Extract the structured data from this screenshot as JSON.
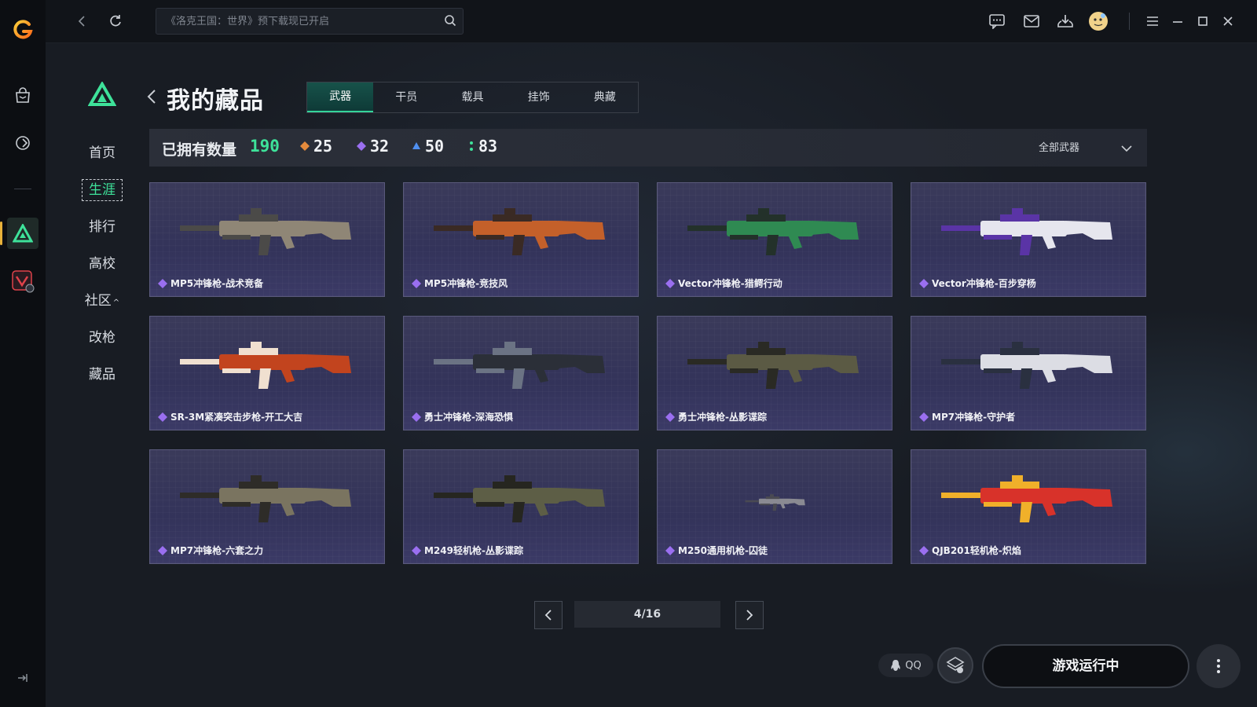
{
  "colors": {
    "accent": "#3ee29a",
    "brand_orange": "#e8b23a",
    "card_bg": "#36365a"
  },
  "topbar": {
    "search_placeholder": "《洛克王国：世界》预下载现已开启",
    "icons": [
      "back-icon",
      "refresh-icon",
      "search-icon",
      "chat-icon",
      "mail-icon",
      "download-icon",
      "avatar",
      "menu-icon",
      "minimize-icon",
      "maximize-icon",
      "close-icon"
    ]
  },
  "rail": {
    "icons": [
      "app-logo",
      "store-icon",
      "game-controller-icon",
      "delta-force-icon",
      "valorant-icon",
      "collapse-icon"
    ]
  },
  "nav": {
    "items": [
      "首页",
      "生涯",
      "排行",
      "高校",
      "社区",
      "改枪",
      "藏品"
    ],
    "active": "生涯"
  },
  "header": {
    "title": "我的藏品",
    "tabs": [
      "武器",
      "干员",
      "载具",
      "挂饰",
      "典藏"
    ],
    "active_tab": "武器"
  },
  "owned": {
    "label": "已拥有数量",
    "total": "190",
    "rarity_counts": [
      {
        "rarity": "orange",
        "color": "#e48a3c",
        "count": "25"
      },
      {
        "rarity": "purple",
        "color": "#9a6ff0",
        "count": "32"
      },
      {
        "rarity": "blue",
        "color": "#4f8ff0",
        "count": "50"
      },
      {
        "rarity": "green",
        "color": "#3ee29a",
        "count": "83"
      }
    ],
    "filter": "全部武器"
  },
  "items": [
    {
      "name": "MP5冲锋枪-战术竞备",
      "gun": "#8f8676",
      "gun2": "#4b4a48"
    },
    {
      "name": "MP5冲锋枪-竞技风",
      "gun": "#c4602a",
      "gun2": "#3a2a24"
    },
    {
      "name": "Vector冲锋枪-猎鳄行动",
      "gun": "#2f8a52",
      "gun2": "#23312a"
    },
    {
      "name": "Vector冲锋枪-百步穿杨",
      "gun": "#e6e6ee",
      "gun2": "#5a34a6"
    },
    {
      "name": "SR-3M紧凑突击步枪-开工大吉",
      "gun": "#c2441e",
      "gun2": "#f0e0d0"
    },
    {
      "name": "勇士冲锋枪-深海恐惧",
      "gun": "#2b2f38",
      "gun2": "#6b7384"
    },
    {
      "name": "勇士冲锋枪-丛影谍踪",
      "gun": "#5b5a44",
      "gun2": "#2a2a24"
    },
    {
      "name": "MP7冲锋枪-守护者",
      "gun": "#dcdde4",
      "gun2": "#2a3040"
    },
    {
      "name": "MP7冲锋枪-六套之力",
      "gun": "#7a7460",
      "gun2": "#2e2c28"
    },
    {
      "name": "M249轻机枪-丛影谍踪",
      "gun": "#5d5e46",
      "gun2": "#262620"
    },
    {
      "name": "M250通用机枪-囚徒",
      "gun": "#8a8a92",
      "gun2": "#4a4a52"
    },
    {
      "name": "QJB201轻机枪-炽焰",
      "gun": "#d8322a",
      "gun2": "#f0b02a"
    }
  ],
  "pagination": {
    "indicator": "4/16"
  },
  "footer": {
    "qq_label": "QQ",
    "run_label": "游戏运行中"
  }
}
